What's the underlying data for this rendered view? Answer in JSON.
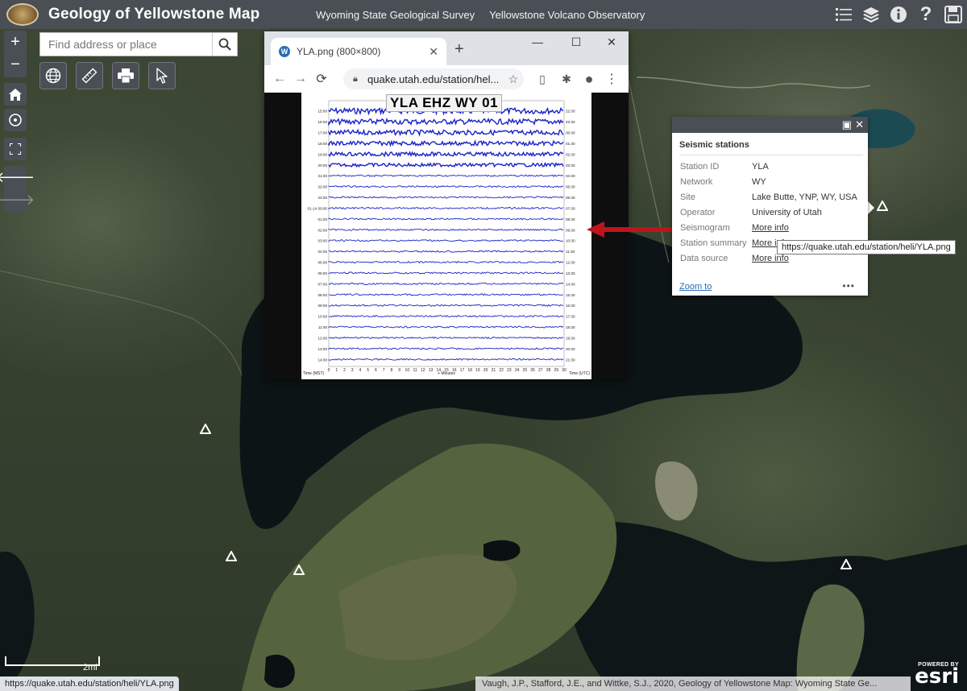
{
  "header": {
    "title": "Geology of Yellowstone Map",
    "links": [
      "Wyoming State Geological Survey",
      "Yellowstone Volcano Observatory"
    ],
    "icons": [
      "list-icon",
      "layers-icon",
      "info-icon",
      "help-icon",
      "save-icon"
    ]
  },
  "search": {
    "placeholder": "Find address or place"
  },
  "browser": {
    "tab_title": "YLA.png (800×800)",
    "address": "quake.utah.edu/station/hel...",
    "image_title": "YLA EHZ WY 01",
    "left_axis_label": "Time (MST)",
    "bottom_axis_label": "+ Minutes",
    "right_axis_label": "Time (UTC)",
    "left_times": [
      "15:00",
      "16:00",
      "17:00",
      "18:00",
      "19:00",
      "20:00",
      "21:00",
      "22:00",
      "23:00",
      "01-14 00:00",
      "01:00",
      "02:00",
      "03:00",
      "04:00",
      "05:00",
      "06:00",
      "07:00",
      "08:00",
      "09:00",
      "10:00",
      "11:00",
      "12:00",
      "13:00",
      "14:00"
    ],
    "right_times": [
      "22:30",
      "23:30",
      "00:30",
      "01:30",
      "02:30",
      "03:30",
      "04:30",
      "05:30",
      "06:30",
      "07:30",
      "08:30",
      "09:30",
      "10:30",
      "11:30",
      "12:30",
      "13:30",
      "14:30",
      "15:30",
      "16:30",
      "17:30",
      "18:30",
      "19:30",
      "20:30",
      "21:30"
    ],
    "minute_ticks": [
      "0",
      "1",
      "2",
      "3",
      "4",
      "5",
      "6",
      "7",
      "8",
      "9",
      "10",
      "11",
      "12",
      "13",
      "14",
      "15",
      "16",
      "17",
      "18",
      "19",
      "20",
      "21",
      "22",
      "23",
      "24",
      "25",
      "26",
      "27",
      "28",
      "29",
      "30"
    ]
  },
  "popup": {
    "title": "Seismic stations",
    "rows": [
      {
        "key": "Station ID",
        "value": "YLA"
      },
      {
        "key": "Network",
        "value": "WY"
      },
      {
        "key": "Site",
        "value": "Lake Butte, YNP, WY, USA"
      },
      {
        "key": "Operator",
        "value": "University of Utah"
      },
      {
        "key": "Seismogram",
        "value": "More info"
      },
      {
        "key": "Station summary",
        "value": "More info"
      },
      {
        "key": "Data source",
        "value": "More info"
      }
    ],
    "zoom_label": "Zoom to",
    "more_label": "•••"
  },
  "tooltip": "https://quake.utah.edu/station/heli/YLA.png",
  "status_url": "https://quake.utah.edu/station/heli/YLA.png",
  "attribution": "Vaugh, J.P., Stafford, J.E., and Wittke, S.J., 2020, Geology of Yellowstone Map: Wyoming State Ge...",
  "scale_label": "2mi",
  "esri": {
    "powered": "POWERED BY",
    "name": "esri"
  },
  "colors": {
    "header": "#4a4f55",
    "link": "#2a6bb1",
    "arrow": "#c0141b",
    "trace": "#1a22c8"
  }
}
